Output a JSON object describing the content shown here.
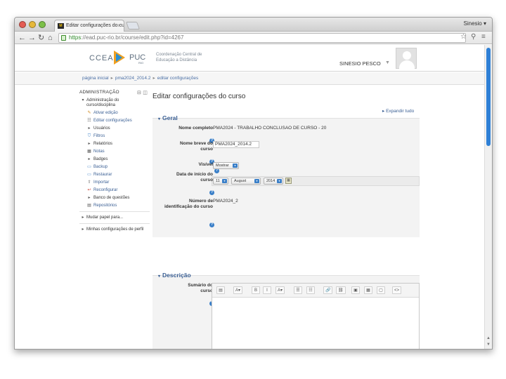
{
  "browser": {
    "tab_title": "Editar configurações do cu",
    "tab_favicon": "M",
    "tab_close": "×",
    "profile_name": "Sinesio ▾",
    "url_scheme": "https",
    "url_rest": "://ead.puc-rio.br/course/edit.php?id=4267",
    "icons": [
      "back-icon",
      "forward-icon",
      "reload-icon",
      "home-icon",
      "lock-icon",
      "star-icon",
      "search-icon",
      "menu-icon"
    ]
  },
  "header": {
    "logo_left": "CCEAD",
    "logo_right": "PUC",
    "logo_rio": "RIO",
    "logo_subtitle": "Coordenação Central de Educação a Distância",
    "user_name": "SINESIO PESCO",
    "user_caret": "▼"
  },
  "breadcrumb": [
    "página inicial",
    "pma2024_2014.2",
    "editar configurações"
  ],
  "breadcrumb_sep": "▸",
  "sidebar": {
    "title": "ADMINISTRAÇÃO",
    "header_icons": "⊟ ◫",
    "items": [
      {
        "label": "Administração do curso/disciplina",
        "icon": "▾",
        "level": 1
      },
      {
        "label": "Ativar edição",
        "icon": "✎",
        "level": 2
      },
      {
        "label": "Editar configurações",
        "icon": "☷",
        "level": 2
      },
      {
        "label": "Usuários",
        "icon": "▸",
        "level": 2
      },
      {
        "label": "Filtros",
        "icon": "⛉",
        "level": 2
      },
      {
        "label": "Relatórios",
        "icon": "▸",
        "level": 2
      },
      {
        "label": "Notas",
        "icon": "▦",
        "level": 2
      },
      {
        "label": "Badges",
        "icon": "▸",
        "level": 2
      },
      {
        "label": "Backup",
        "icon": "▭",
        "level": 2
      },
      {
        "label": "Restaurar",
        "icon": "▭",
        "level": 2
      },
      {
        "label": "Importar",
        "icon": "⇧",
        "level": 2
      },
      {
        "label": "Reconfigurar",
        "icon": "↩",
        "level": 2
      },
      {
        "label": "Banco de questões",
        "icon": "▸",
        "level": 2
      },
      {
        "label": "Repositórios",
        "icon": "▤",
        "level": 2
      }
    ],
    "extra_items": [
      {
        "label": "Mudar papel para...",
        "icon": "▸"
      },
      {
        "label": "Minhas configurações de perfil",
        "icon": "▸"
      }
    ]
  },
  "main": {
    "title": "Editar configurações do curso",
    "expand_all": "▸ Expandir tudo",
    "general_legend": "Geral",
    "legend_icon": "▾",
    "help_glyph": "?",
    "fields": {
      "fullname_label": "Nome completo",
      "fullname_value": "PMA2024 - TRABALHO CONCLUSAO DE CURSO - 20",
      "shortname_label": "Nome breve do curso",
      "shortname_value": "PMA2024_2014.2",
      "visible_label": "Visível",
      "visible_value": "Mostrar",
      "startdate_label": "Data de início do curso",
      "start_day": "11",
      "start_month": "August",
      "start_year": "2014",
      "idnumber_label": "Número de identificação do curso",
      "idnumber_value": "PMA2024_2"
    },
    "description_legend": "Descrição",
    "summary_label": "Sumário do curso",
    "editor_buttons": [
      "▤",
      "A▾",
      "B",
      "I",
      "A▾",
      "☰",
      "☷",
      "🔗",
      "⛓",
      "▣",
      "▦",
      "▢",
      "<>"
    ],
    "select_arrow": "▾",
    "calendar_glyph": "▦"
  },
  "colors": {
    "link": "#3a5f94",
    "help": "#3a7fc8",
    "scroll_thumb": "#2f80d6",
    "logo_orange": "#f0a020",
    "logo_blue": "#2b8fd0"
  }
}
